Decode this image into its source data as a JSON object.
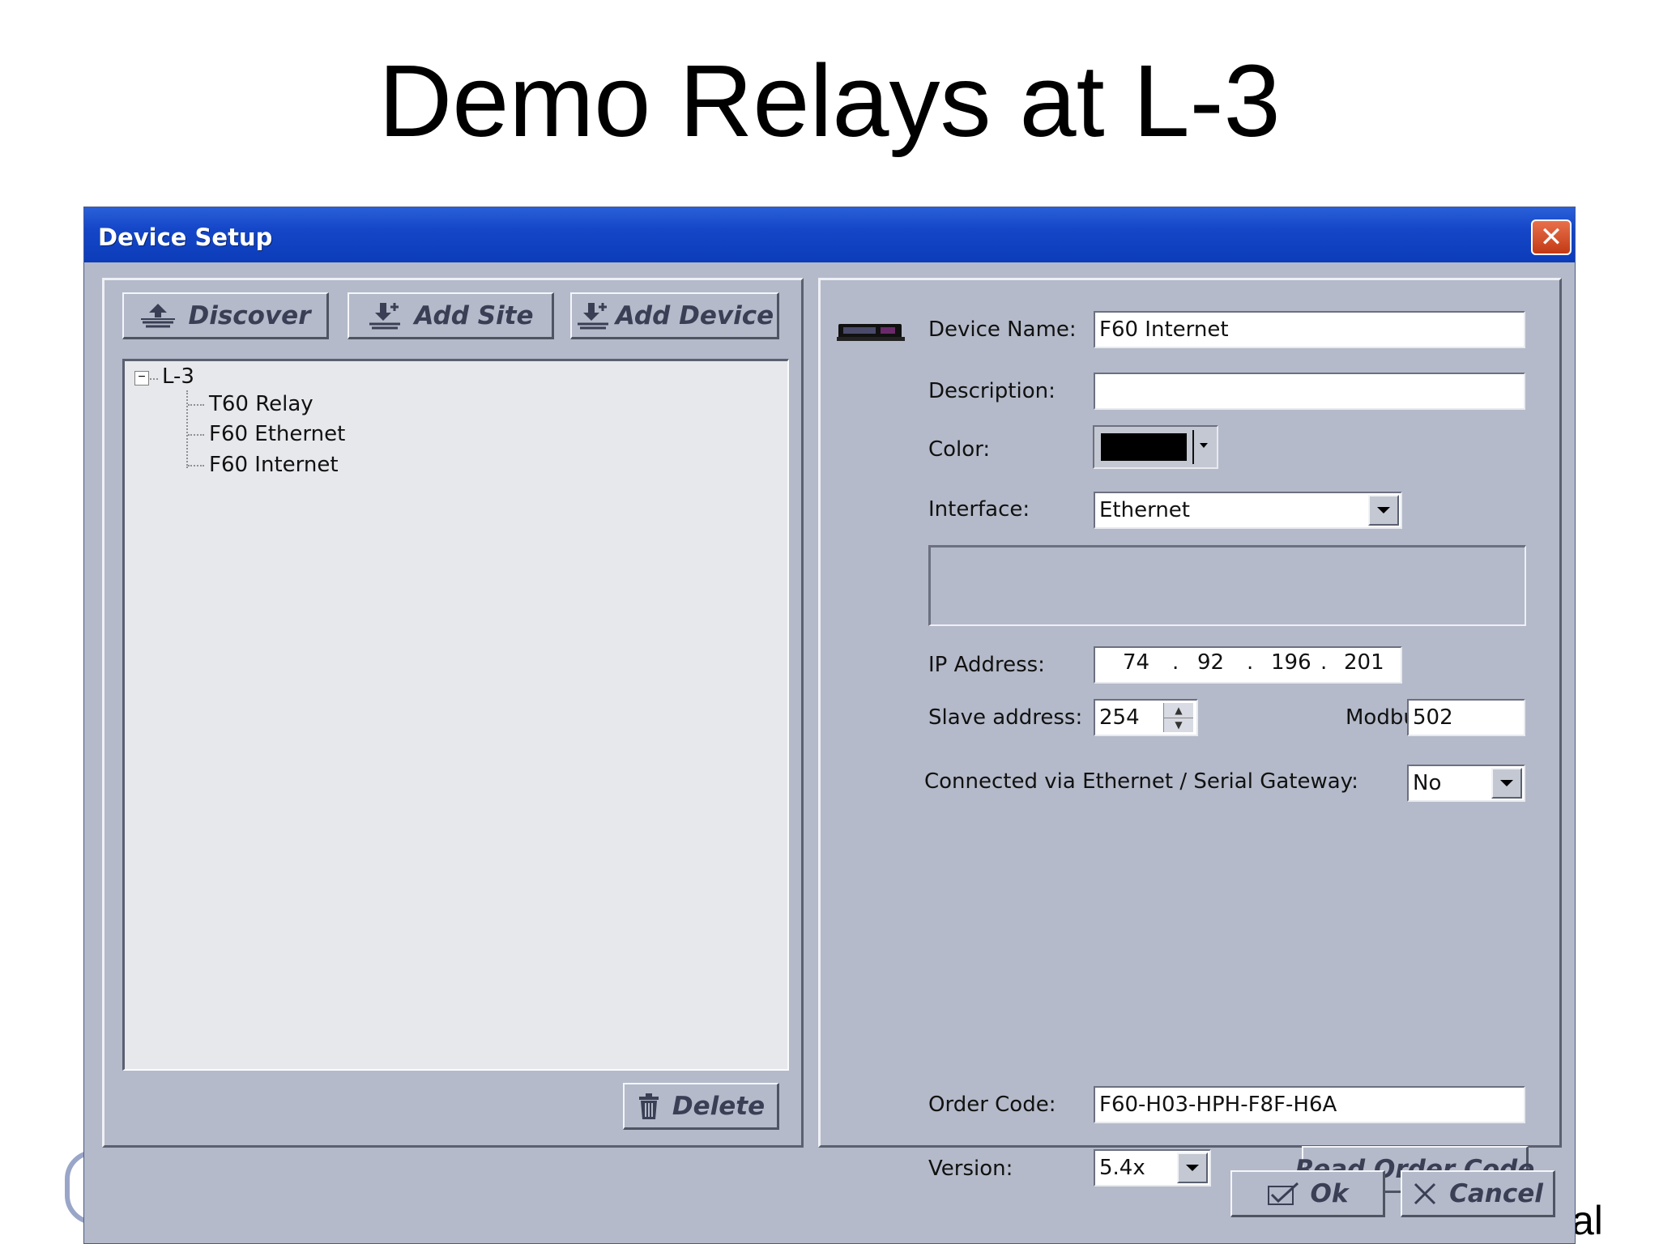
{
  "slide": {
    "title": "Demo Relays at L-3",
    "fragment": "al"
  },
  "window": {
    "title": "Device Setup",
    "close_label": "✕"
  },
  "toolbar": {
    "discover_label": "Discover",
    "add_site_label": "Add Site",
    "add_device_label": "Add Device"
  },
  "tree": {
    "root": {
      "label": "L-3",
      "expander": "−"
    },
    "items": [
      {
        "label": "T60 Relay"
      },
      {
        "label": "F60 Ethernet"
      },
      {
        "label": "F60 Internet"
      }
    ]
  },
  "delete_label": "Delete",
  "form": {
    "device_name_label": "Device Name:",
    "device_name_value": "F60 Internet",
    "description_label": "Description:",
    "description_value": "",
    "color_label": "Color:",
    "color_value": "#000000",
    "interface_label": "Interface:",
    "interface_value": "Ethernet",
    "ip_label": "IP Address:",
    "ip_segments": [
      "74",
      "92",
      "196",
      "201"
    ],
    "ip_dot": ".",
    "slave_label": "Slave address:",
    "slave_value": "254",
    "modbus_label": "Modbus Port:",
    "modbus_value": "502",
    "gateway_label": "Connected via  Ethernet / Serial Gateway:",
    "gateway_value": "No",
    "order_code_label": "Order Code:",
    "order_code_value": "F60-H03-HPH-F8F-H6A",
    "version_label": "Version:",
    "version_value": "5.4x",
    "read_order_code_label": "Read Order Code"
  },
  "footer": {
    "ok_label": "Ok",
    "cancel_label": "Cancel"
  },
  "colors": {
    "titlebar": "#1446c8",
    "dialog_bg": "#b4bac9",
    "tree_bg": "#e7e8ec",
    "close": "#c23a14"
  }
}
